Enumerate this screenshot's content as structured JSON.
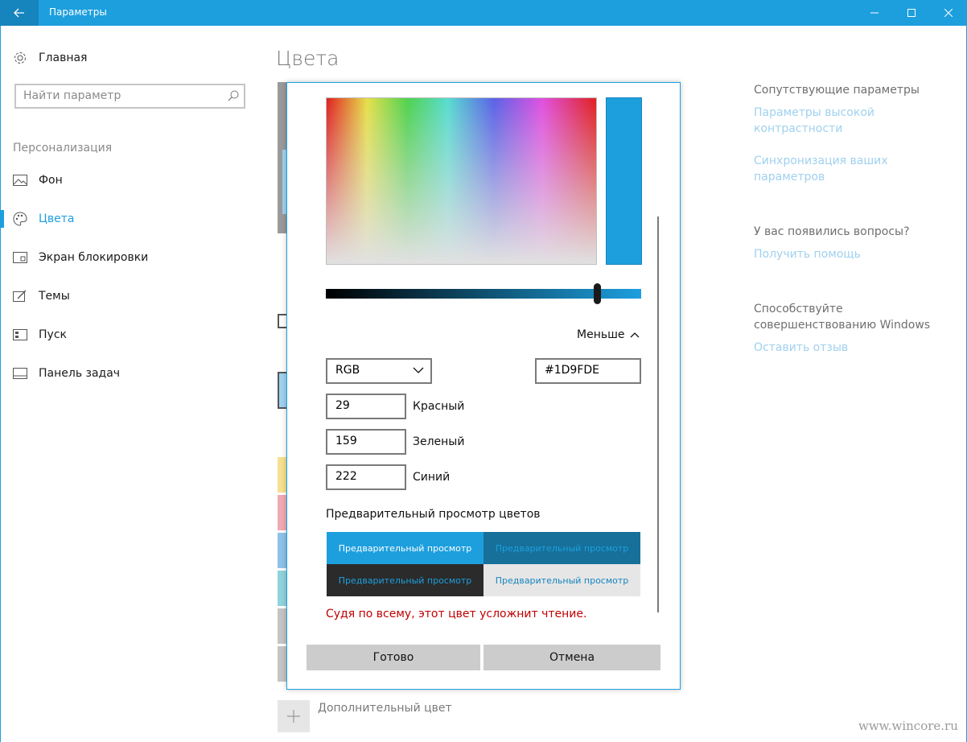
{
  "window": {
    "title": "Параметры"
  },
  "sidebar": {
    "home_label": "Главная",
    "search_placeholder": "Найти параметр",
    "section_label": "Персонализация",
    "items": [
      {
        "label": "Фон",
        "icon": "picture-icon"
      },
      {
        "label": "Цвета",
        "icon": "palette-icon",
        "active": true
      },
      {
        "label": "Экран блокировки",
        "icon": "lock-screen-icon"
      },
      {
        "label": "Темы",
        "icon": "themes-icon"
      },
      {
        "label": "Пуск",
        "icon": "start-icon"
      },
      {
        "label": "Панель задач",
        "icon": "taskbar-icon"
      }
    ]
  },
  "main": {
    "title": "Цвета",
    "add_color_label": "Дополнительный цвет"
  },
  "right_column": {
    "related_heading": "Сопутствующие параметры",
    "link_high_contrast": "Параметры высокой контрастности",
    "link_sync": "Синхронизация ваших параметров",
    "questions_heading": "У вас появились вопросы?",
    "link_help": "Получить помощь",
    "feedback_heading": "Способствуйте совершенствованию Windows",
    "link_feedback": "Оставить отзыв"
  },
  "dialog": {
    "selected_color": "#1D9FDE",
    "brightness_level": 0.86,
    "less_label": "Меньше",
    "color_model": "RGB",
    "hex_value": "#1D9FDE",
    "red_value": "29",
    "red_label": "Красный",
    "green_value": "159",
    "green_label": "Зеленый",
    "blue_value": "222",
    "blue_label": "Синий",
    "preview_title": "Предварительный просмотр цветов",
    "preview_text": "Предварительный просмотр",
    "warning": "Судя по всему, этот цвет усложнит чтение.",
    "ok_label": "Готово",
    "cancel_label": "Отмена"
  },
  "watermark": "www.wincore.ru",
  "colors": {
    "accent": "#1d9fde",
    "accent_dark": "#1684bd",
    "warning": "#c00000"
  }
}
